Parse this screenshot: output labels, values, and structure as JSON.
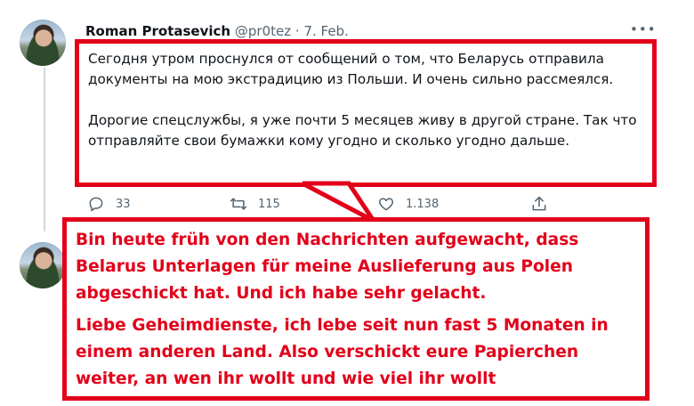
{
  "tweet": {
    "author_name": "Roman Protasevich",
    "handle": "@pr0tez",
    "date": "7. Feb.",
    "paragraphs": [
      "Сегодня утром проснулся от сообщений о том, что Беларусь отправила документы на мою экстрадицию из Польши. И очень сильно рассмеялся.",
      "Дорогие спецслужбы, я уже почти 5 месяцев живу в другой стране. Так что отправляйте свои бумажки кому угодно и сколько угодно дальше."
    ],
    "actions": {
      "reply_count": "33",
      "retweet_count": "115",
      "like_count": "1.138"
    }
  },
  "translation": {
    "paragraphs": [
      "Bin heute früh von den Nachrichten aufgewacht, dass Belarus Unterlagen für meine Auslieferung aus Polen abgeschickt hat. Und ich habe sehr gelacht.",
      "Liebe Geheimdienste, ich lebe seit nun fast 5 Monaten in einem anderen Land. Also verschickt eure Papierchen weiter, an wen ihr wollt und wie viel ihr wollt"
    ]
  },
  "colors": {
    "annotation_red": "#e2001a",
    "muted_text": "#536471"
  },
  "icons": [
    "more-icon",
    "reply-icon",
    "retweet-icon",
    "like-icon",
    "share-icon"
  ]
}
